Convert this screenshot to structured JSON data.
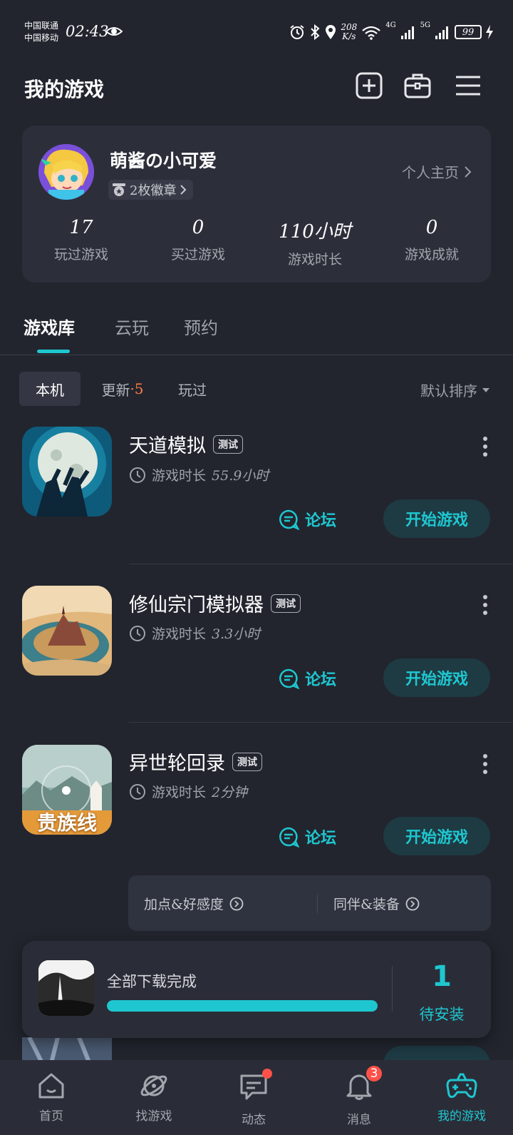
{
  "status_bar": {
    "carrier1": "中国联通",
    "carrier2": "中国移动",
    "time": "02:43",
    "net_speed": "208",
    "net_unit": "K/s",
    "net1": "4G",
    "net2": "5G",
    "battery": "99"
  },
  "header": {
    "title": "我的游戏"
  },
  "profile": {
    "username": "萌酱の小可爱",
    "badges": "2枚徽章",
    "homepage_link": "个人主页",
    "stats": [
      {
        "value": "17",
        "label": "玩过游戏"
      },
      {
        "value": "0",
        "label": "买过游戏"
      },
      {
        "value": "110小时",
        "label": "游戏时长"
      },
      {
        "value": "0",
        "label": "游戏成就"
      }
    ]
  },
  "tabs": [
    {
      "label": "游戏库",
      "active": true
    },
    {
      "label": "云玩",
      "active": false
    },
    {
      "label": "预约",
      "active": false
    }
  ],
  "subtabs": {
    "local": "本机",
    "update": "更新",
    "update_count": "·5",
    "played": "玩过",
    "sort": "默认排序"
  },
  "games": [
    {
      "name": "天道模拟",
      "tag": "测试",
      "time_label": "游戏时长",
      "time": "55.9小时",
      "forum": "论坛",
      "play": "开始游戏"
    },
    {
      "name": "修仙宗门模拟器",
      "tag": "测试",
      "time_label": "游戏时长",
      "time": "3.3小时",
      "forum": "论坛",
      "play": "开始游戏"
    },
    {
      "name": "异世轮回录",
      "tag": "测试",
      "time_label": "游戏时长",
      "time": "2分钟",
      "forum": "论坛",
      "play": "开始游戏",
      "icon_text": "贵族线"
    }
  ],
  "guides": [
    "加点&好感度",
    "同伴&装备"
  ],
  "download": {
    "title": "全部下载完成",
    "progress": 1.0,
    "count": "1",
    "count_label": "待安装"
  },
  "nav": [
    {
      "label": "首页"
    },
    {
      "label": "找游戏"
    },
    {
      "label": "动态"
    },
    {
      "label": "消息",
      "badge": "3"
    },
    {
      "label": "我的游戏"
    }
  ],
  "colors": {
    "accent": "#1ec7d0",
    "background": "#22252e",
    "alert": "#ff5149"
  }
}
